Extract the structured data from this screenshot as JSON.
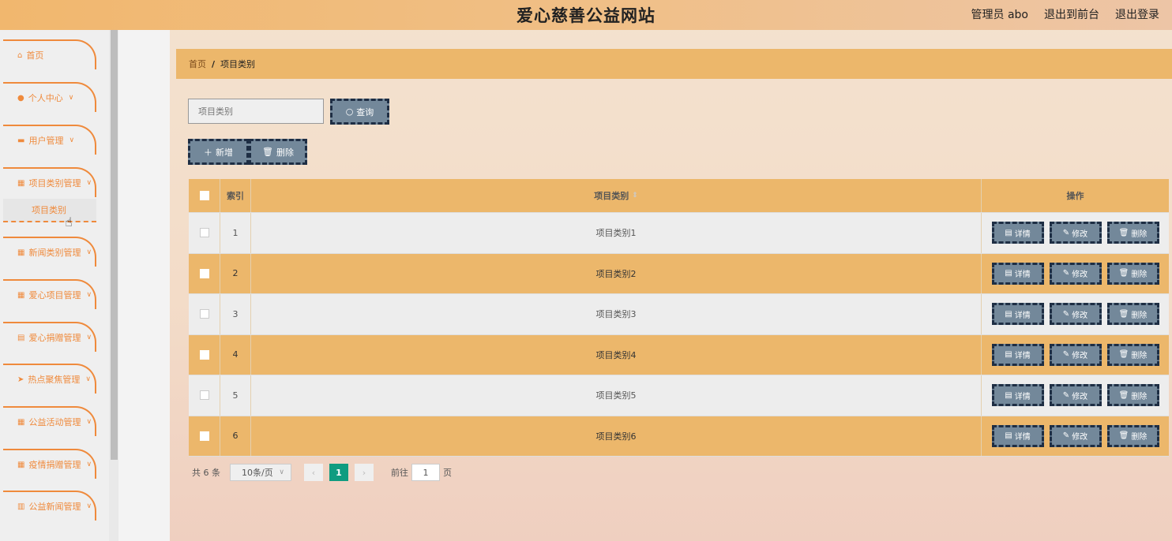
{
  "header": {
    "title": "爱心慈善公益网站",
    "admin": "管理员 abo",
    "to_front": "退出到前台",
    "logout": "退出登录"
  },
  "sidebar": {
    "items": [
      {
        "label": "首页",
        "icon": "home-icon"
      },
      {
        "label": "个人中心",
        "icon": "user-icon"
      },
      {
        "label": "用户管理",
        "icon": "chat-icon"
      },
      {
        "label": "项目类别管理",
        "icon": "grid-icon"
      },
      {
        "label": "新闻类别管理",
        "icon": "grid-icon"
      },
      {
        "label": "爱心项目管理",
        "icon": "grid-icon"
      },
      {
        "label": "爱心捐赠管理",
        "icon": "list-icon"
      },
      {
        "label": "热点聚焦管理",
        "icon": "send-icon"
      },
      {
        "label": "公益活动管理",
        "icon": "grid-icon"
      },
      {
        "label": "疫情捐赠管理",
        "icon": "grid-icon"
      },
      {
        "label": "公益新闻管理",
        "icon": "bar-chart-icon"
      }
    ],
    "active_sub": "项目类别"
  },
  "breadcrumb": {
    "home": "首页",
    "separator": "/",
    "current": "项目类别"
  },
  "search": {
    "placeholder": "项目类别",
    "query_label": "查询"
  },
  "toolbar": {
    "add_label": "新增",
    "delete_label": "删除"
  },
  "table": {
    "headers": {
      "index": "索引",
      "name": "项目类别",
      "ops": "操作"
    },
    "rows": [
      {
        "index": "1",
        "name": "项目类别1"
      },
      {
        "index": "2",
        "name": "项目类别2"
      },
      {
        "index": "3",
        "name": "项目类别3"
      },
      {
        "index": "4",
        "name": "项目类别4"
      },
      {
        "index": "5",
        "name": "项目类别5"
      },
      {
        "index": "6",
        "name": "项目类别6"
      }
    ],
    "ops": {
      "detail": "详情",
      "edit": "修改",
      "delete": "删除"
    }
  },
  "pagination": {
    "total": "共 6 条",
    "page_size": "10条/页",
    "current_page": "1",
    "goto_prefix": "前往",
    "goto_value": "1",
    "goto_suffix": "页"
  },
  "colors": {
    "accent": "#ecb76b",
    "menu": "#ef8a3c",
    "button": "#73889a",
    "pager_active": "#0f9c80"
  }
}
